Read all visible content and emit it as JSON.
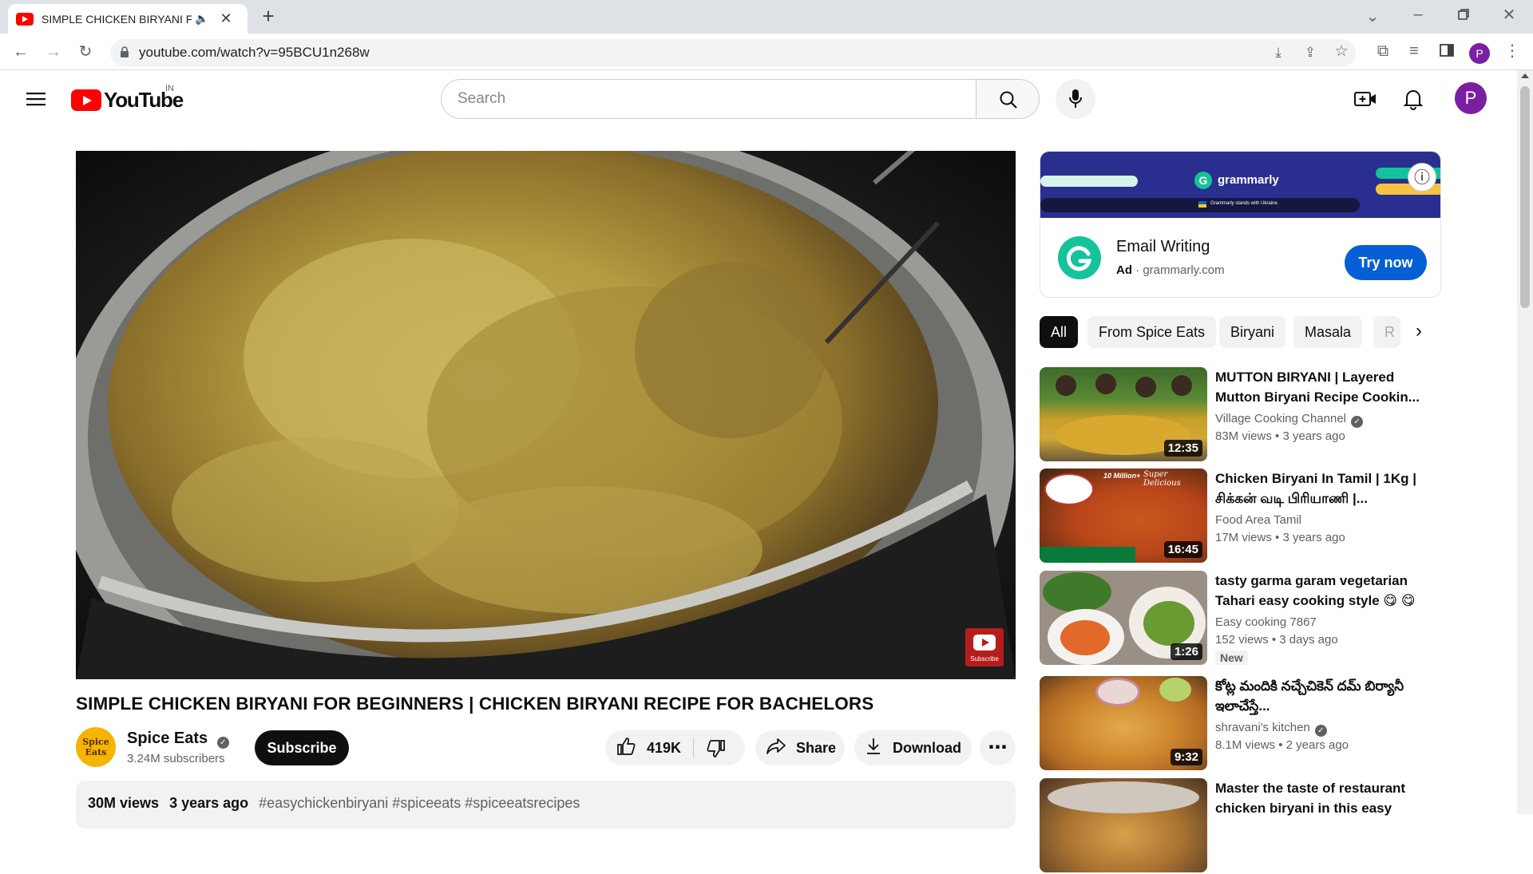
{
  "browser": {
    "tab_title": "SIMPLE CHICKEN BIRYANI FOR BEGINNERS",
    "url": "youtube.com/watch?v=95BCU1n268w",
    "profile_initial": "P"
  },
  "header": {
    "logo_text": "YouTube",
    "country": "IN",
    "search_placeholder": "Search",
    "avatar_initial": "P"
  },
  "video": {
    "title": "SIMPLE CHICKEN BIRYANI FOR BEGINNERS | CHICKEN BIRYANI RECIPE FOR BACHELORS",
    "watermark_label": "Subscribe",
    "channel_name": "Spice Eats",
    "channel_logo_text": "Spice Eats",
    "subscribers": "3.24M subscribers",
    "subscribe_label": "Subscribe",
    "likes": "419K",
    "share_label": "Share",
    "download_label": "Download",
    "views": "30M views",
    "posted": "3 years ago",
    "hashtags": "#easychickenbiryani #spiceeats #spiceeatsrecipes"
  },
  "ad": {
    "banner_brand": "grammarly",
    "banner_small": "Grammarly stands with Ukraine.",
    "title": "Email Writing",
    "badge": "Ad",
    "domain": "grammarly.com",
    "cta": "Try now"
  },
  "chips": [
    "All",
    "From Spice Eats",
    "Biryani",
    "Masala",
    "R"
  ],
  "recommendations": [
    {
      "title": "MUTTON BIRYANI | Layered Mutton Biryani Recipe Cookin...",
      "channel": "Village Cooking Channel",
      "verified": true,
      "views": "83M views",
      "age": "3 years ago",
      "duration": "12:35"
    },
    {
      "title": "Chicken Biryani In Tamil | 1Kg | சிக்கன் வடி பிரியாணி |...",
      "channel": "Food Area Tamil",
      "verified": false,
      "views": "17M views",
      "age": "3 years ago",
      "duration": "16:45"
    },
    {
      "title": "tasty garma garam vegetarian Tahari easy cooking style 😋 😋",
      "channel": "Easy cooking 7867",
      "verified": false,
      "views": "152 views",
      "age": "3 days ago",
      "duration": "1:26",
      "badge": "New"
    },
    {
      "title": "కోట్ల మందికి నచ్చేచికెన్ దమ్ బిర్యానీ ఇలాచేస్తే...",
      "channel": "shravani's kitchen",
      "verified": true,
      "views": "8.1M views",
      "age": "2 years ago",
      "duration": "9:32"
    },
    {
      "title": "Master the taste of restaurant chicken biryani in this easy way!",
      "channel": "",
      "verified": false,
      "views": "",
      "age": "",
      "duration": ""
    }
  ],
  "colors": {
    "yt_red": "#ff0000",
    "subscribe_bg": "#0f0f0f",
    "cta_blue": "#065fd4",
    "grammarly_green": "#15c39a",
    "avatar_purple": "#7b1fa2"
  }
}
